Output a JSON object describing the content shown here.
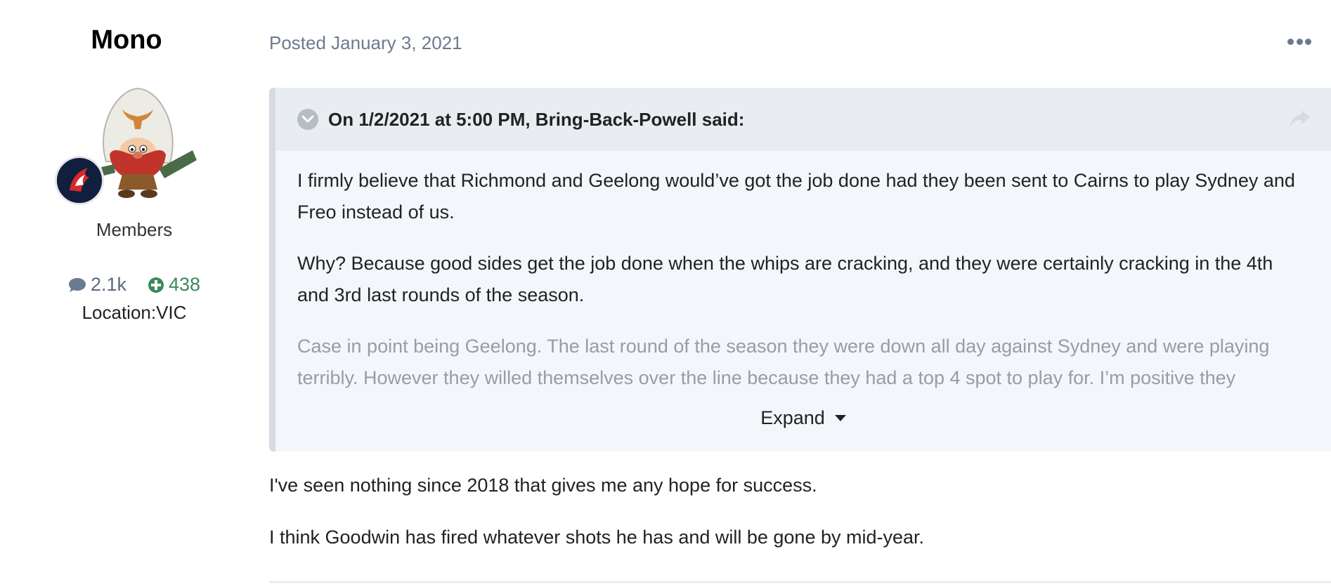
{
  "author": {
    "username": "Mono",
    "group": "Members",
    "posts_count": "2.1k",
    "reputation": "438",
    "location": "Location:VIC",
    "avatar_icon": "yosemite-sam-avatar",
    "badge_icon": "demon-team-badge"
  },
  "post": {
    "posted_label": "Posted January 3, 2021",
    "more_icon": "ellipsis-icon",
    "quote": {
      "citation": "On 1/2/2021 at 5:00 PM, Bring-Back-Powell said:",
      "paragraphs": [
        "I firmly believe that Richmond and Geelong would’ve got the job done had they been sent to Cairns to play Sydney and Freo instead of us.",
        "Why? Because good sides get the job done when the whips are cracking, and they were certainly cracking in the 4th and 3rd last rounds of the season.",
        "Case in point being Geelong. The last round of the season they were down all day against Sydney and were playing terribly. However they willed themselves over the line because they had a top 4 spot to play for. I’m positive they"
      ],
      "expand_label": "Expand"
    },
    "body": [
      "I've seen nothing since 2018 that gives me any hope for success.",
      "I think Goodwin has fired whatever shots he has and will be gone by mid-year."
    ]
  },
  "colors": {
    "meta_text": "#6b7b8f",
    "reputation_green": "#3a8a5c",
    "quote_bg": "#f3f6fa",
    "quote_header_bg": "#e9edf2"
  }
}
